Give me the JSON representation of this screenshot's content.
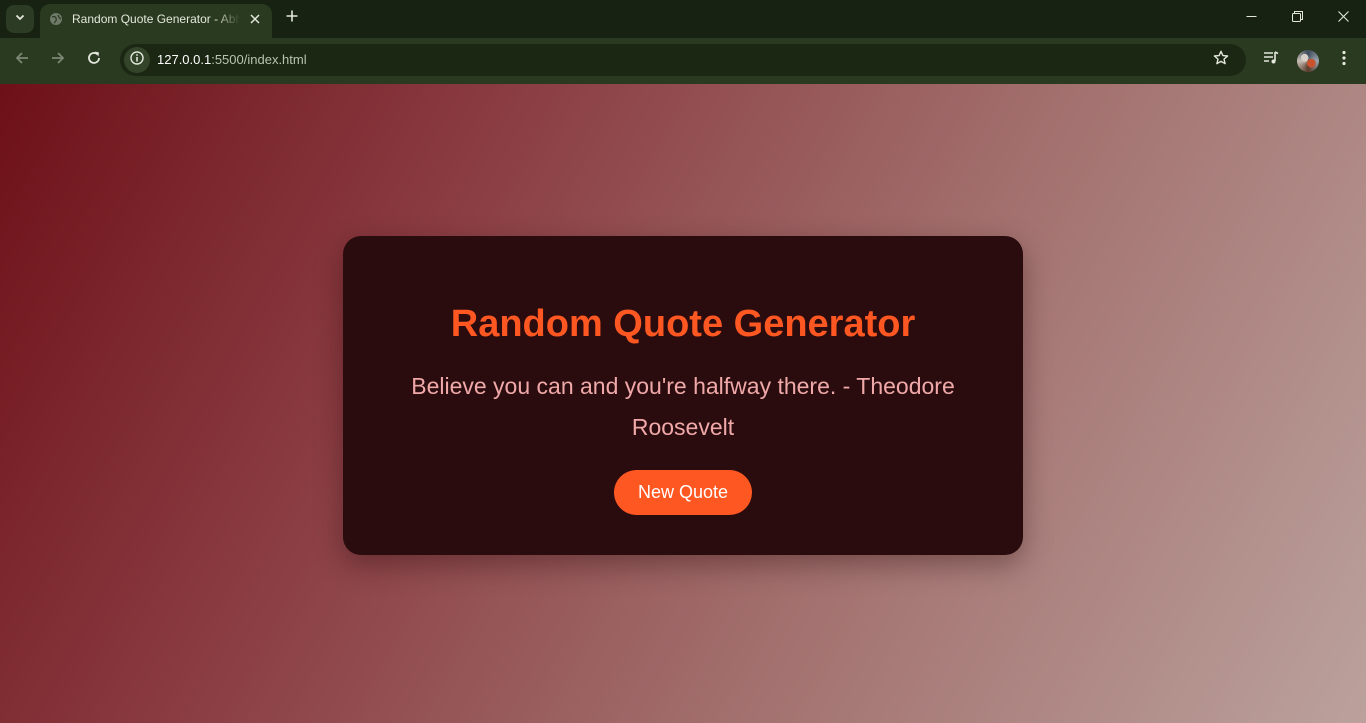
{
  "browser": {
    "tab_title": "Random Quote Generator - Abhi",
    "url_host": "127.0.0.1",
    "url_path": ":5500/index.html"
  },
  "icons": {
    "tab_search": "chevron-down-icon",
    "favicon": "globe-icon",
    "tab_close": "close-icon",
    "new_tab": "plus-icon",
    "minimize": "minimize-icon",
    "restore": "restore-icon",
    "close_window": "close-icon",
    "back": "arrow-left-icon",
    "forward": "arrow-right-icon",
    "reload": "reload-icon",
    "site_info": "info-icon",
    "bookmark": "star-icon",
    "media": "media-control-icon",
    "profile": "avatar",
    "menu": "kebab-menu-icon"
  },
  "page": {
    "title": "Random Quote Generator",
    "quote": "Believe you can and you're halfway there. - Theodore Roosevelt",
    "button_label": "New Quote"
  },
  "colors": {
    "accent": "#ff5722",
    "card_background": "#2a0c0e",
    "quote_text": "#f0a8a8",
    "gradient_start": "#6e1018",
    "gradient_end": "#bba19c"
  }
}
